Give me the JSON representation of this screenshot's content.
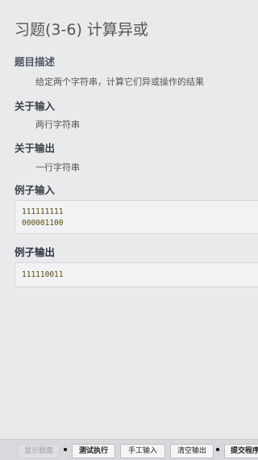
{
  "title": "习题(3-6) 计算异或",
  "sections": {
    "description": {
      "heading": "题目描述",
      "text": "给定两个字符串，计算它们异或操作的结果"
    },
    "input": {
      "heading": "关于输入",
      "text": "两行字符串"
    },
    "output": {
      "heading": "关于输出",
      "text": "一行字符串"
    },
    "sample_input": {
      "heading": "例子输入",
      "lines": [
        "111111111",
        "000001100"
      ]
    },
    "sample_output": {
      "heading": "例子输出",
      "lines": [
        "111110011"
      ]
    }
  },
  "toolbar": {
    "show_title": "显示题面",
    "test_run": "测试执行",
    "manual_input": "手工输入",
    "clear_output": "清空输出",
    "submit": "提交程序"
  }
}
